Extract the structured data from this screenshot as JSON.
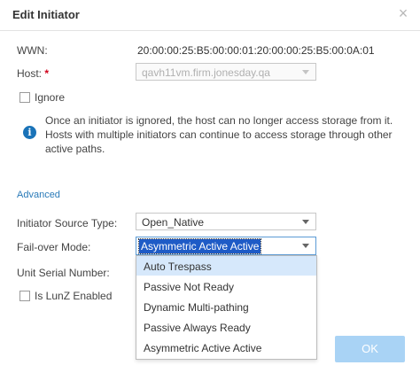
{
  "dialog": {
    "title": "Edit Initiator",
    "close_glyph": "×"
  },
  "wwn": {
    "label": "WWN:",
    "value": "20:00:00:25:B5:00:00:01:20:00:00:25:B5:00:0A:01"
  },
  "host": {
    "label": "Host:",
    "required_mark": "*",
    "value": "qavh11vm.firm.jonesday.qa"
  },
  "ignore": {
    "label": "Ignore",
    "checked": false,
    "info_text": "Once an initiator is ignored, the host can no longer access storage from it. Hosts with multiple initiators can continue to access storage through other active paths."
  },
  "advanced": {
    "link": "Advanced"
  },
  "source_type": {
    "label": "Initiator Source Type:",
    "value": "Open_Native"
  },
  "failover": {
    "label": "Fail-over Mode:",
    "value": "Asymmetric Active Active",
    "options": [
      "Auto Trespass",
      "Passive Not Ready",
      "Dynamic Multi-pathing",
      "Passive Always Ready",
      "Asymmetric Active Active"
    ]
  },
  "unit_serial": {
    "label": "Unit Serial Number:"
  },
  "lunz": {
    "label": "Is LunZ Enabled",
    "checked": false
  },
  "buttons": {
    "ok": "OK"
  },
  "colors": {
    "accent": "#1a73b8",
    "selection": "#1e5bc6",
    "hover": "#d6e8fb",
    "ok_disabled": "#a9d3f5",
    "required": "#d0021b"
  }
}
